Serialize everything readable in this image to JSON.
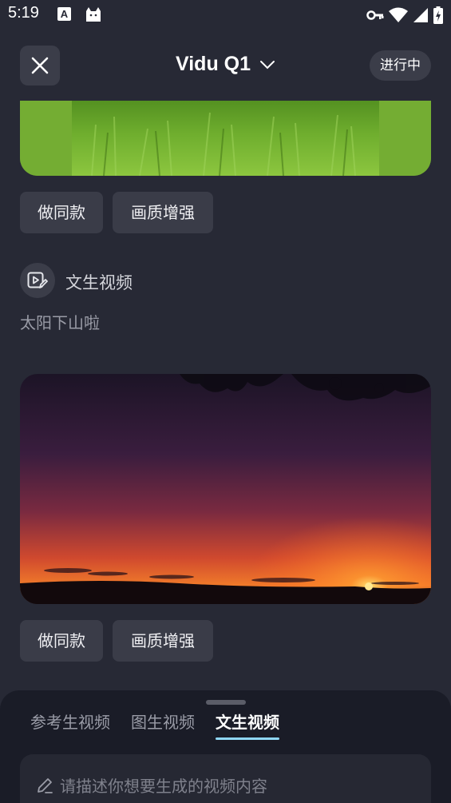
{
  "status_bar": {
    "time": "5:19",
    "notif_a": "A"
  },
  "header": {
    "model_name": "Vidu Q1",
    "status_label": "进行中"
  },
  "cards": [
    {
      "actions": [
        "做同款",
        "画质增强"
      ]
    },
    {
      "mode_label": "文生视频",
      "prompt": "太阳下山啦",
      "actions": [
        "做同款",
        "画质增强"
      ]
    }
  ],
  "bottom_sheet": {
    "tabs": [
      "参考生视频",
      "图生视频",
      "文生视频"
    ],
    "active_tab": 2,
    "input_placeholder": "请描述你想要生成的视频内容"
  },
  "colors": {
    "background": "#272935",
    "button": "#3a3c48",
    "sheet": "#1a1c27",
    "tab_underline": "#8fd7f6"
  }
}
